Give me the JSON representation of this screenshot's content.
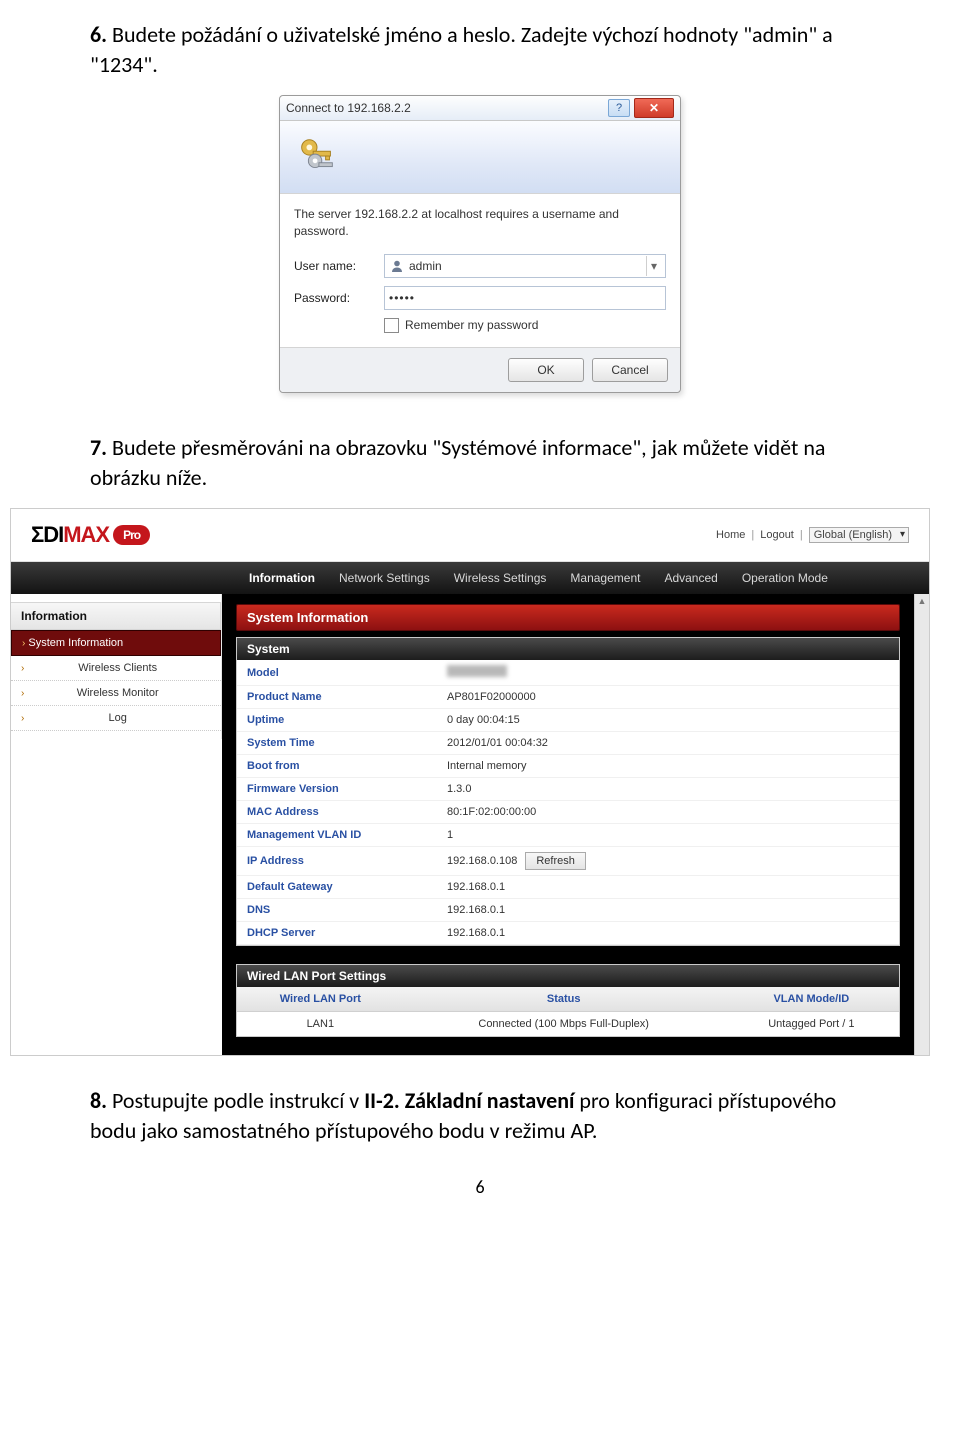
{
  "para6": {
    "num": "6.",
    "text": " Budete požádání o uživatelské jméno a heslo. Zadejte výchozí hodnoty \"admin\" a \"1234\"."
  },
  "authDialog": {
    "title": "Connect to 192.168.2.2",
    "message": "The server 192.168.2.2 at localhost requires a username and password.",
    "userLabel": "User name:",
    "userValue": "admin",
    "passLabel": "Password:",
    "passValue": "•••••",
    "remember": "Remember my password",
    "ok": "OK",
    "cancel": "Cancel"
  },
  "para7": {
    "num": "7.",
    "text": " Budete přesměrováni na obrazovku \"Systémové informace\", jak můžete vidět na obrázku níže."
  },
  "router": {
    "logoPrefix": "ΣDI",
    "logoMid": "MAX",
    "logoPro": "Pro",
    "topLinks": {
      "home": "Home",
      "logout": "Logout"
    },
    "language": "Global (English)",
    "nav": [
      "Information",
      "Network Settings",
      "Wireless Settings",
      "Management",
      "Advanced",
      "Operation Mode"
    ],
    "sidebar": {
      "title": "Information",
      "items": [
        "System Information",
        "Wireless Clients",
        "Wireless Monitor",
        "Log"
      ]
    },
    "sectionTitle": "System Information",
    "systemHead": "System",
    "system": [
      {
        "k": "Model",
        "v": ""
      },
      {
        "k": "Product Name",
        "v": "AP801F02000000"
      },
      {
        "k": "Uptime",
        "v": "0 day 00:04:15"
      },
      {
        "k": "System Time",
        "v": "2012/01/01 00:04:32"
      },
      {
        "k": "Boot from",
        "v": "Internal memory"
      },
      {
        "k": "Firmware Version",
        "v": "1.3.0"
      },
      {
        "k": "MAC Address",
        "v": "80:1F:02:00:00:00"
      },
      {
        "k": "Management VLAN ID",
        "v": "1"
      },
      {
        "k": "IP Address",
        "v": "192.168.0.108"
      },
      {
        "k": "Default Gateway",
        "v": "192.168.0.1"
      },
      {
        "k": "DNS",
        "v": "192.168.0.1"
      },
      {
        "k": "DHCP Server",
        "v": "192.168.0.1"
      }
    ],
    "refresh": "Refresh",
    "lanHead": "Wired LAN Port Settings",
    "lanHeaders": [
      "Wired LAN Port",
      "Status",
      "VLAN Mode/ID"
    ],
    "lanRow": [
      "LAN1",
      "Connected (100 Mbps Full-Duplex)",
      "Untagged Port  /   1"
    ]
  },
  "para8": {
    "num": "8.",
    "text_a": " Postupujte podle instrukcí v ",
    "bold": "II-2. Základní nastavení",
    "text_b": " pro konfiguraci přístupového bodu jako samostatného přístupového bodu v režimu AP."
  },
  "pageNumber": "6"
}
